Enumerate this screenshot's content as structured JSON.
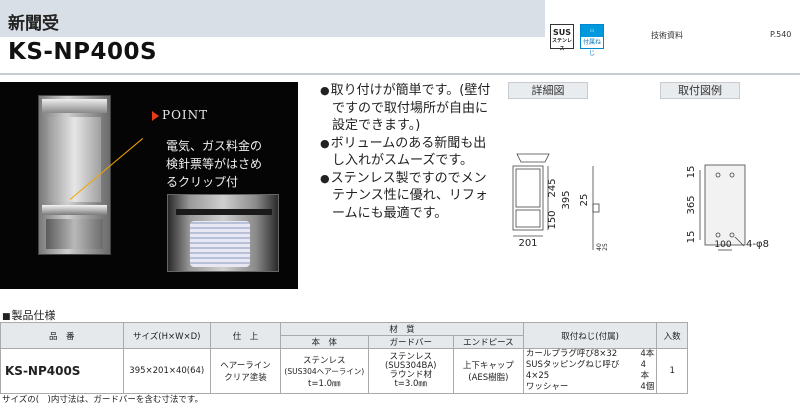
{
  "header": {
    "category": "新聞受",
    "model": "KS-NP400S",
    "badges": {
      "sus_top": "SUS",
      "sus_bottom": "ステンレス",
      "screw_label": "付属ねじ"
    },
    "tech_label": "技術資料",
    "page_number": "P.540"
  },
  "photo": {
    "point_label": "POINT",
    "point_lines": [
      "電気、ガス料金の",
      "検針票等がはさめ",
      "るクリップ付"
    ]
  },
  "features": [
    "取り付けが簡単です。(壁付ですので取付場所が自由に設定できます。)",
    "ボリュームのある新聞も出し入れがスムーズです。",
    "ステンレス製ですのでメンテナンス性に優れ、リフォームにも最適です。"
  ],
  "detail": {
    "title": "詳細図",
    "dims": {
      "top": "245",
      "bottom": "150",
      "total": "395",
      "width": "201",
      "depth": "25",
      "side_a": "40",
      "side_b": "25"
    }
  },
  "mount": {
    "title": "取付図例",
    "dims": {
      "top": "15",
      "mid": "365",
      "bottom": "15",
      "width": "100",
      "hole": "4-φ8"
    }
  },
  "spec": {
    "title": "製品仕様",
    "headers": {
      "model": "品　番",
      "size": "サイズ(H×W×D)",
      "finish": "仕　上",
      "material": "材　質",
      "body": "本　体",
      "guard": "ガードバー",
      "endpiece": "エンドピース",
      "screws": "取付ねじ(付属)",
      "qty": "入数"
    },
    "row": {
      "model": "KS-NP400S",
      "size": "395×201×40(64)",
      "finish": [
        "ヘアーライン",
        "クリア塗装"
      ],
      "body": [
        "ステンレス",
        "(SUS304ヘアーライン)",
        "t=1.0㎜"
      ],
      "guard": [
        "ステンレス",
        "(SUS304BA)",
        "ラウンド材",
        "t=3.0㎜"
      ],
      "endpiece": [
        "上下キャップ",
        "(AES樹脂)"
      ],
      "screws": [
        {
          "name": "カールプラグ呼び8×32",
          "count": "4本"
        },
        {
          "name": "SUSタッピングねじ呼び4×25",
          "count": "4本"
        },
        {
          "name": "ワッシャー",
          "count": "4個"
        }
      ],
      "qty": "1"
    },
    "footnote": "サイズの(　)内寸法は、ガードバーを含む寸法です。"
  }
}
